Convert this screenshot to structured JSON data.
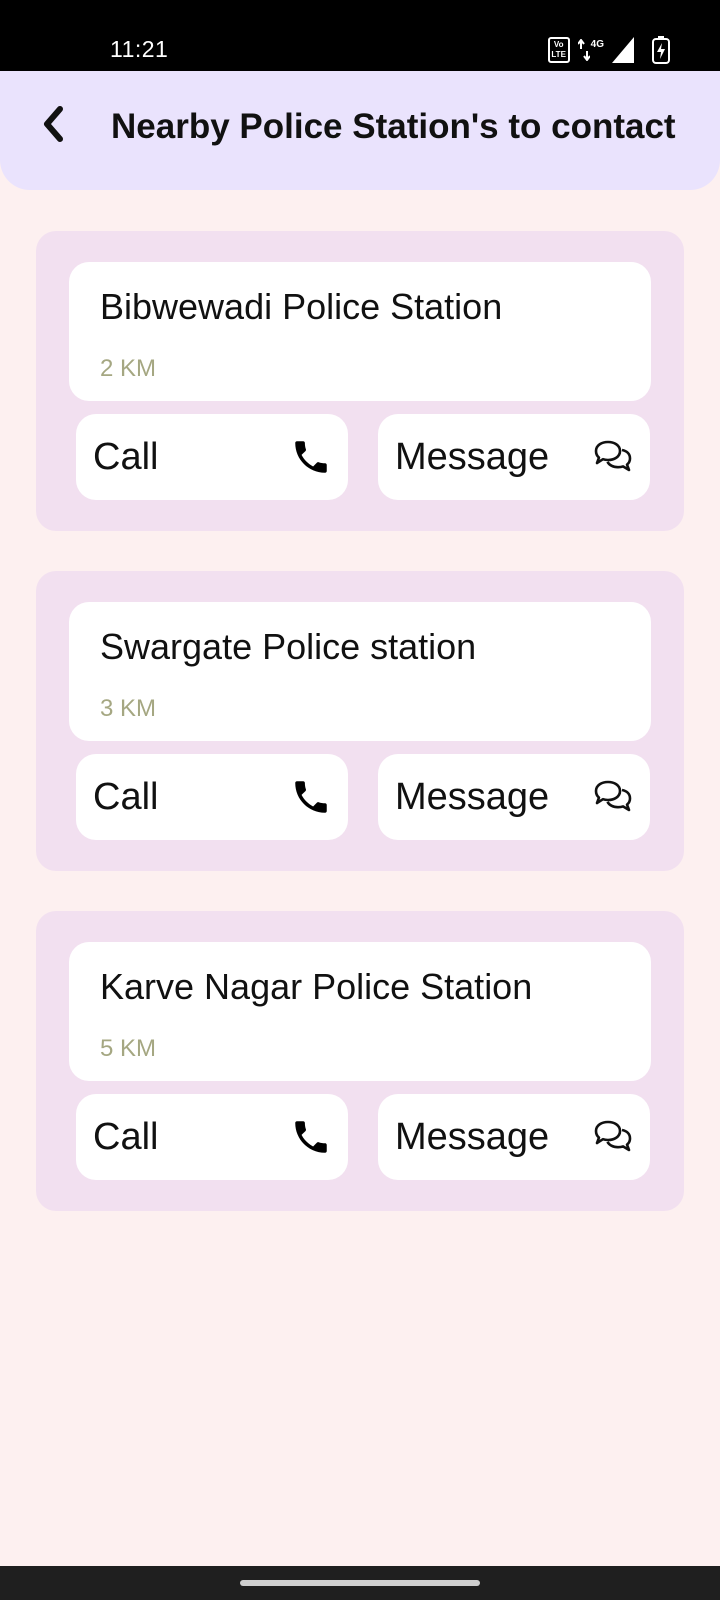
{
  "status_bar": {
    "time": "11:21",
    "volte_top": "Vo",
    "volte_bottom": "LTE",
    "network": "4G",
    "icons": [
      "volte-icon",
      "data-arrows-icon",
      "signal-icon",
      "battery-charging-icon"
    ]
  },
  "app_bar": {
    "title": "Nearby Police Station's to contact",
    "back_icon": "chevron-left-icon"
  },
  "colors": {
    "background": "#fdf0f0",
    "app_bar": "#eae3fd",
    "card": "#f2e0f0",
    "distance_text": "#a5a782"
  },
  "stations": [
    {
      "name": "Bibwewadi Police Station",
      "distance": "2 KM",
      "call_label": "Call",
      "message_label": "Message"
    },
    {
      "name": "Swargate Police station",
      "distance": "3 KM",
      "call_label": "Call",
      "message_label": "Message"
    },
    {
      "name": "Karve Nagar Police Station",
      "distance": "5 KM",
      "call_label": "Call",
      "message_label": "Message"
    }
  ]
}
